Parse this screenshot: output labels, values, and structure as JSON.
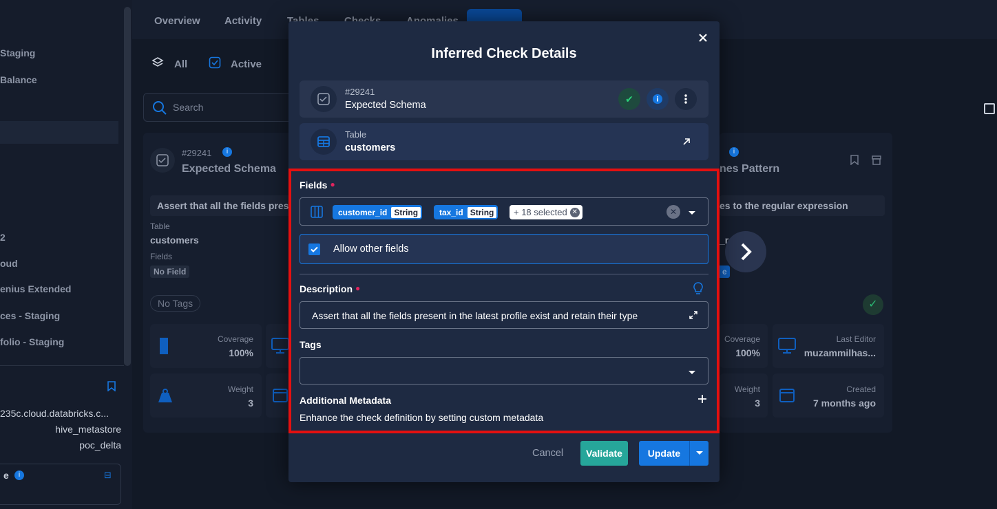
{
  "background": {
    "sidebar_items": [
      "Staging",
      "Balance",
      "2",
      "oud",
      "enius Extended",
      "ces - Staging",
      "folio - Staging"
    ],
    "sidebar_details": [
      "235c.cloud.databricks.c...",
      "hive_metastore",
      "poc_delta"
    ],
    "tabs": [
      "Overview",
      "Activity",
      "Tables",
      "Checks",
      "Anomalies"
    ],
    "filters": {
      "all": "All",
      "active": "Active"
    },
    "search_placeholder": "Search",
    "card_left": {
      "id": "#29241",
      "title": "Expected Schema",
      "description": "Assert that all the fields pres",
      "table_label": "Table",
      "table_value": "customers",
      "fields_label": "Fields",
      "fields_value": "No Field",
      "tags": "No Tags",
      "coverage_label": "Coverage",
      "coverage_value": "100%",
      "weight_label": "Weight",
      "weight_value": "3"
    },
    "card_right": {
      "title": "nes Pattern",
      "description": "es to the regular expression",
      "coverage_label": "Coverage",
      "coverage_value": "100%",
      "editor_label": "Last Editor",
      "editor_value": "muzammilhas...",
      "weight_label": "Weight",
      "weight_value": "3",
      "created_label": "Created",
      "created_value": "7 months ago",
      "fragment_r": "_r",
      "fragment_e": "e"
    }
  },
  "modal": {
    "title": "Inferred Check Details",
    "check": {
      "id": "#29241",
      "name": "Expected Schema"
    },
    "table": {
      "label": "Table",
      "name": "customers"
    },
    "fields": {
      "label": "Fields",
      "chips": [
        {
          "name": "customer_id",
          "type": "String"
        },
        {
          "name": "tax_id",
          "type": "String"
        }
      ],
      "more": "+ 18 selected"
    },
    "allow_other_fields": {
      "label": "Allow other fields",
      "checked": true
    },
    "description": {
      "label": "Description",
      "value": "Assert that all the fields present in the latest profile exist and retain their type"
    },
    "tags": {
      "label": "Tags",
      "value": ""
    },
    "metadata": {
      "label": "Additional Metadata",
      "hint": "Enhance the check definition by setting custom metadata"
    },
    "buttons": {
      "cancel": "Cancel",
      "validate": "Validate",
      "update": "Update"
    }
  },
  "colors": {
    "accent": "#1677e0",
    "validate": "#26a69a",
    "highlight": "#e41010",
    "modal_bg": "#1e2a42"
  }
}
